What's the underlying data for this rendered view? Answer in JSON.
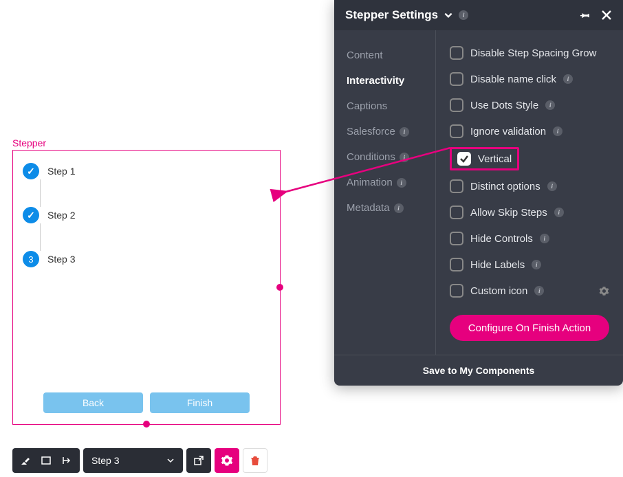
{
  "stepper": {
    "label": "Stepper",
    "steps": [
      {
        "label": "Step 1",
        "state": "completed"
      },
      {
        "label": "Step 2",
        "state": "completed"
      },
      {
        "label": "Step 3",
        "state": "current",
        "number": "3"
      }
    ],
    "back_label": "Back",
    "finish_label": "Finish"
  },
  "toolbar": {
    "selected_step": "Step 3"
  },
  "panel": {
    "title": "Stepper Settings",
    "sidebar": {
      "items": [
        {
          "label": "Content",
          "info": false
        },
        {
          "label": "Interactivity",
          "active": true,
          "info": false
        },
        {
          "label": "Captions",
          "info": false
        },
        {
          "label": "Salesforce",
          "info": true
        },
        {
          "label": "Conditions",
          "info": true
        },
        {
          "label": "Animation",
          "info": true
        },
        {
          "label": "Metadata",
          "info": true
        }
      ]
    },
    "options": [
      {
        "label": "Disable Step Spacing Grow",
        "checked": false,
        "info": false
      },
      {
        "label": "Disable name click",
        "checked": false,
        "info": true
      },
      {
        "label": "Use Dots Style",
        "checked": false,
        "info": true
      },
      {
        "label": "Ignore validation",
        "checked": false,
        "info": true
      },
      {
        "label": "Vertical",
        "checked": true,
        "info": false,
        "highlight": true
      },
      {
        "label": "Distinct options",
        "checked": false,
        "info": true
      },
      {
        "label": "Allow Skip Steps",
        "checked": false,
        "info": true
      },
      {
        "label": "Hide Controls",
        "checked": false,
        "info": true
      },
      {
        "label": "Hide Labels",
        "checked": false,
        "info": true
      },
      {
        "label": "Custom icon",
        "checked": false,
        "info": true,
        "gear": true
      }
    ],
    "finish_action_label": "Configure On Finish Action",
    "footer_label": "Save to My Components"
  }
}
